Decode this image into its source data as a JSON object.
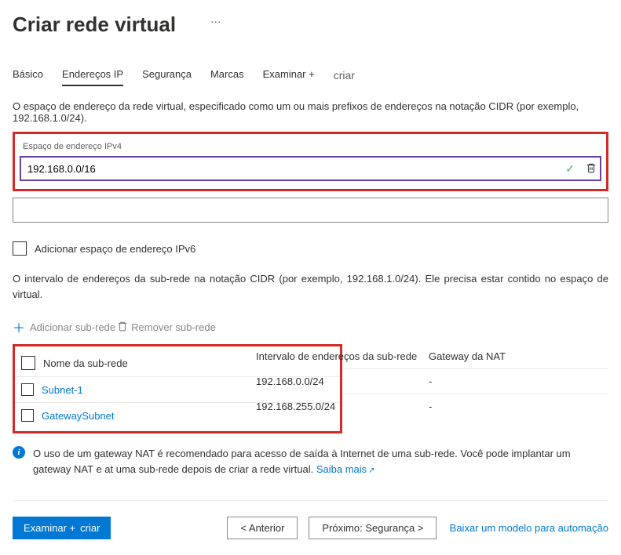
{
  "page_title": "Criar rede virtual",
  "tabs": {
    "basic": "Básico",
    "ip": "Endereços IP",
    "security": "Segurança",
    "tags": "Marcas",
    "review": "Examinar +",
    "create": "criar"
  },
  "ip_desc": "O espaço de endereço da rede virtual, especificado como um ou mais prefixos de endereços na notação CIDR (por exemplo, 192.168.1.0/24).",
  "ipv4_label": "Espaço de endereço IPv4",
  "ipv4_value": "192.168.0.0/16",
  "ipv6_checkbox": "Adicionar espaço de endereço IPv6",
  "subnet_desc": "O intervalo de endereços da sub-rede na notação CIDR (por exemplo, 192.168.1.0/24). Ele precisa estar contido no espaço de virtual.",
  "add_subnet": "Adicionar sub-rede",
  "remove_subnet": "Remover sub-rede",
  "table": {
    "header_name": "Nome da sub-rede",
    "header_range": "Intervalo de endereços da sub-rede",
    "header_nat": "Gateway da NAT",
    "rows": [
      {
        "name": "Subnet-1",
        "range": "192.168.0.0/24",
        "nat": "-"
      },
      {
        "name": "GatewaySubnet",
        "range": "192.168.255.0/24",
        "nat": "-"
      }
    ]
  },
  "info_text_1": "O uso de um gateway NAT é recomendado para acesso de saída à Internet de uma sub-rede. Você pode implantar um gateway NAT e at uma sub-rede depois de criar a rede virtual. ",
  "info_link": "Saiba mais",
  "footer": {
    "review": "Examinar +",
    "create": "criar",
    "previous": "<  Anterior",
    "next": "Próximo: Segurança  >",
    "download": "Baixar um modelo para automação"
  }
}
